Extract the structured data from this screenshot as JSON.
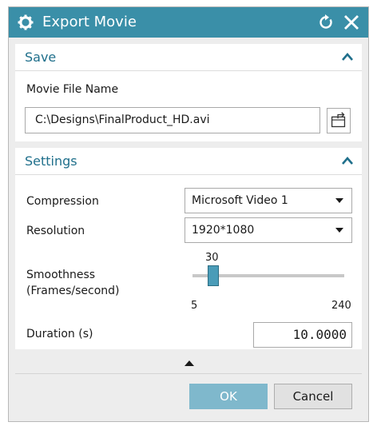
{
  "window": {
    "title": "Export Movie",
    "accent_color": "#3a8fa8",
    "title_icon": "gear-icon",
    "reset_icon": "reset-icon",
    "close_icon": "close-icon"
  },
  "save_section": {
    "header": "Save",
    "file_label": "Movie File Name",
    "file_value": "C:\\Designs\\FinalProduct_HD.avi",
    "browse_icon": "browse-folder-icon"
  },
  "settings_section": {
    "header": "Settings",
    "compression_label": "Compression",
    "compression_value": "Microsoft Video 1",
    "resolution_label": "Resolution",
    "resolution_value": "1920*1080",
    "smoothness_label_line1": "Smoothness",
    "smoothness_label_line2": "(Frames/second)",
    "smoothness_value": "30",
    "smoothness_min": "5",
    "smoothness_max": "240",
    "duration_label": "Duration (s)",
    "duration_value": "10.0000"
  },
  "footer": {
    "ok_label": "OK",
    "cancel_label": "Cancel",
    "ok_color": "#7fb8cc"
  }
}
